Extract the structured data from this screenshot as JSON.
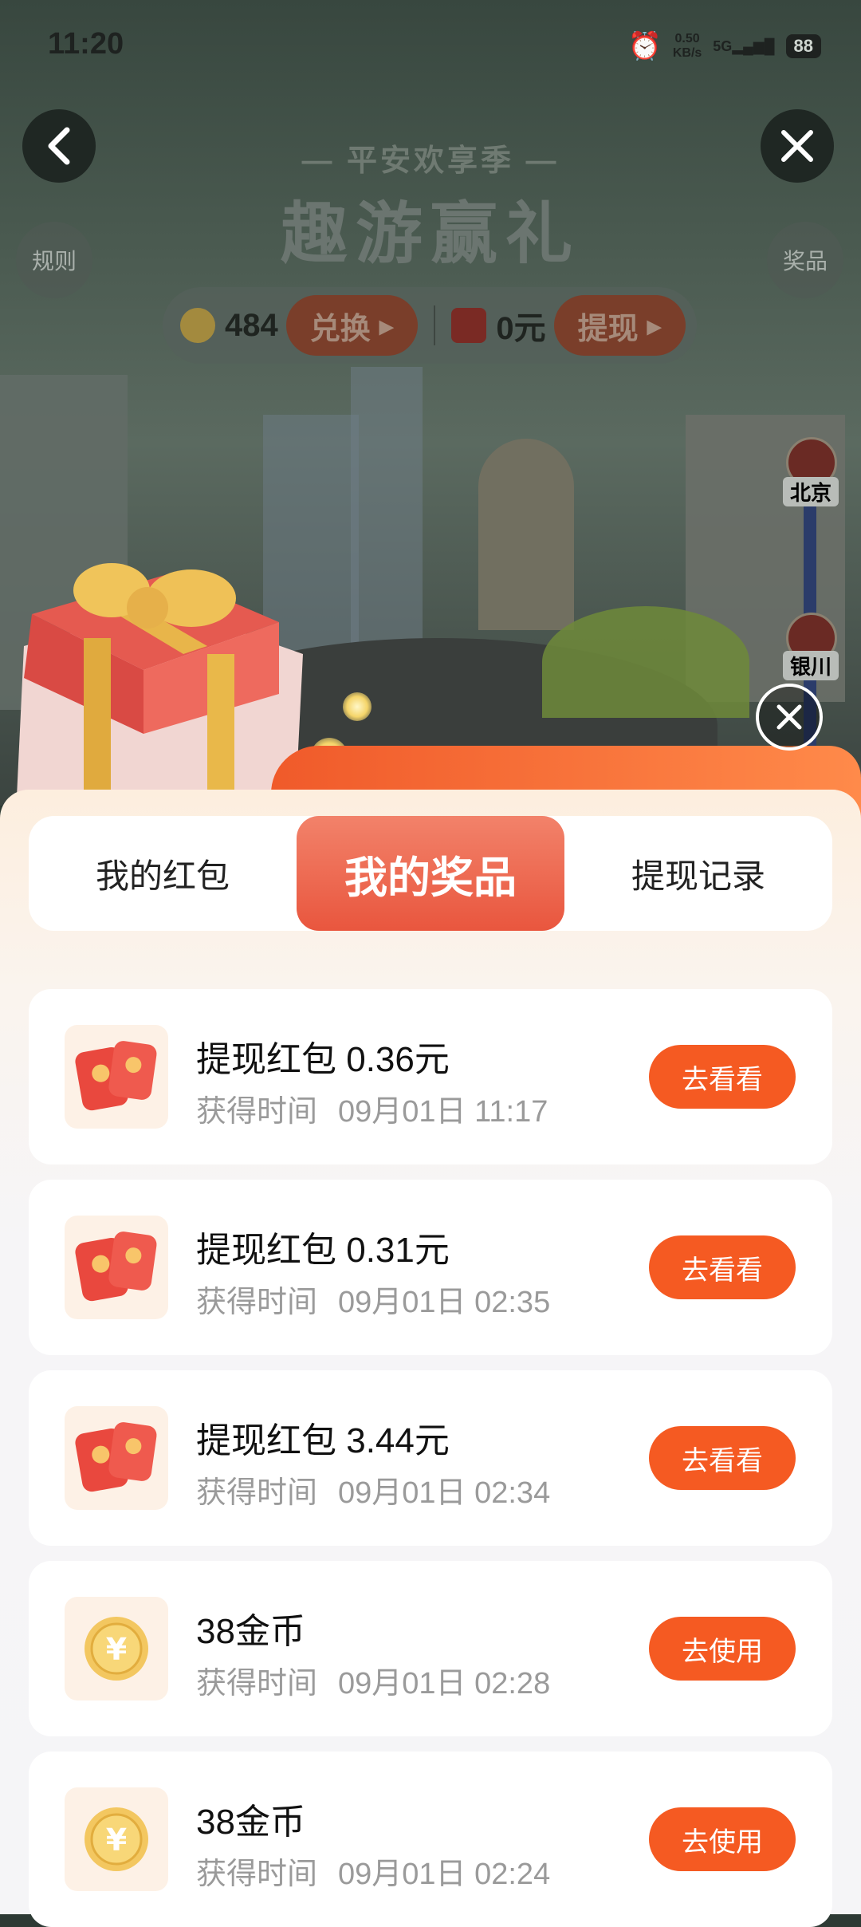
{
  "status": {
    "time": "11:20",
    "net_speed": "0.50",
    "net_unit": "KB/s",
    "net_type": "5G",
    "battery": "88"
  },
  "header": {
    "subtitle": "— 平安欢享季 —",
    "title": "趣游赢礼",
    "rules_label": "规则",
    "prizes_label": "奖品"
  },
  "wallet": {
    "coins": "484",
    "exchange_label": "兑换",
    "cash": "0元",
    "withdraw_label": "提现"
  },
  "route": {
    "city_top": "北京",
    "city_bottom": "银川"
  },
  "tabs": [
    "我的红包",
    "我的奖品",
    "提现记录"
  ],
  "active_tab": "我的奖品",
  "time_label": "获得时间",
  "items": [
    {
      "type": "red-packet",
      "title": "提现红包 0.36元",
      "time": "09月01日 11:17",
      "action": "去看看"
    },
    {
      "type": "red-packet",
      "title": "提现红包 0.31元",
      "time": "09月01日 02:35",
      "action": "去看看"
    },
    {
      "type": "red-packet",
      "title": "提现红包 3.44元",
      "time": "09月01日 02:34",
      "action": "去看看"
    },
    {
      "type": "coin",
      "title": "38金币",
      "time": "09月01日 02:28",
      "action": "去使用"
    },
    {
      "type": "coin",
      "title": "38金币",
      "time": "09月01日 02:24",
      "action": "去使用"
    }
  ],
  "colors": {
    "accent": "#f55a22",
    "tab_active": "#e9563e",
    "muted_text": "#9a9a9a"
  }
}
